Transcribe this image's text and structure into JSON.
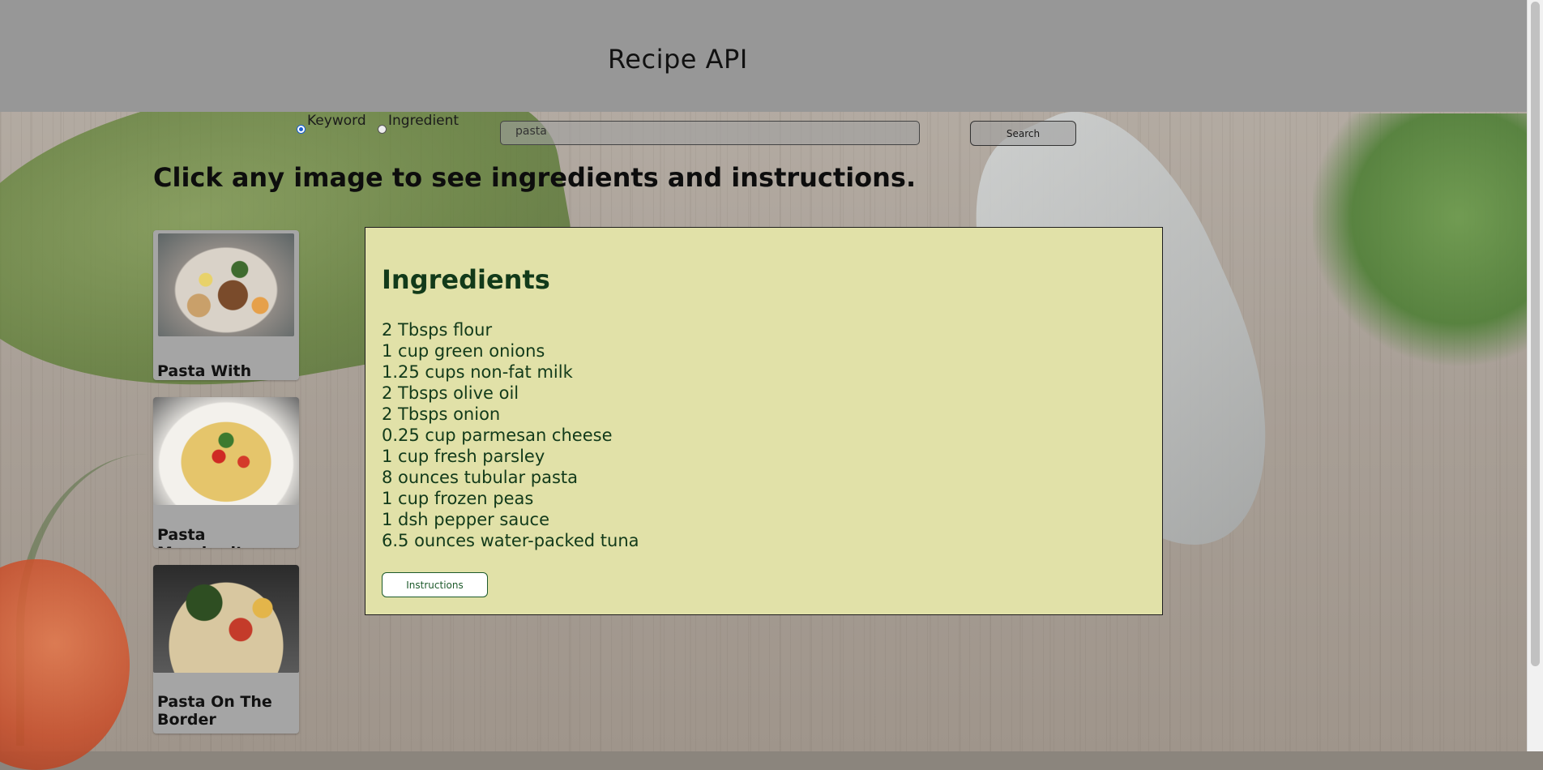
{
  "header": {
    "title": "Recipe API"
  },
  "search": {
    "options": [
      {
        "label": "Keyword",
        "checked": true
      },
      {
        "label": "Ingredient",
        "checked": false
      }
    ],
    "query": "pasta",
    "button_label": "Search"
  },
  "instruction_text": "Click any image to see ingredients and instructions.",
  "recipes": [
    {
      "title": "Pasta With Tuna"
    },
    {
      "title": "Pasta Margherita"
    },
    {
      "title": "Pasta On The Border"
    }
  ],
  "ingredients_panel": {
    "title": "Ingredients",
    "items": [
      "2 Tbsps flour",
      "1 cup green onions",
      "1.25 cups non-fat milk",
      "2 Tbsps olive oil",
      "2 Tbsps onion",
      "0.25 cup parmesan cheese",
      "1 cup fresh parsley",
      "8 ounces tubular pasta",
      "1 cup frozen peas",
      "1 dsh pepper sauce",
      "6.5 ounces water-packed tuna"
    ],
    "button_label": "Instructions"
  }
}
